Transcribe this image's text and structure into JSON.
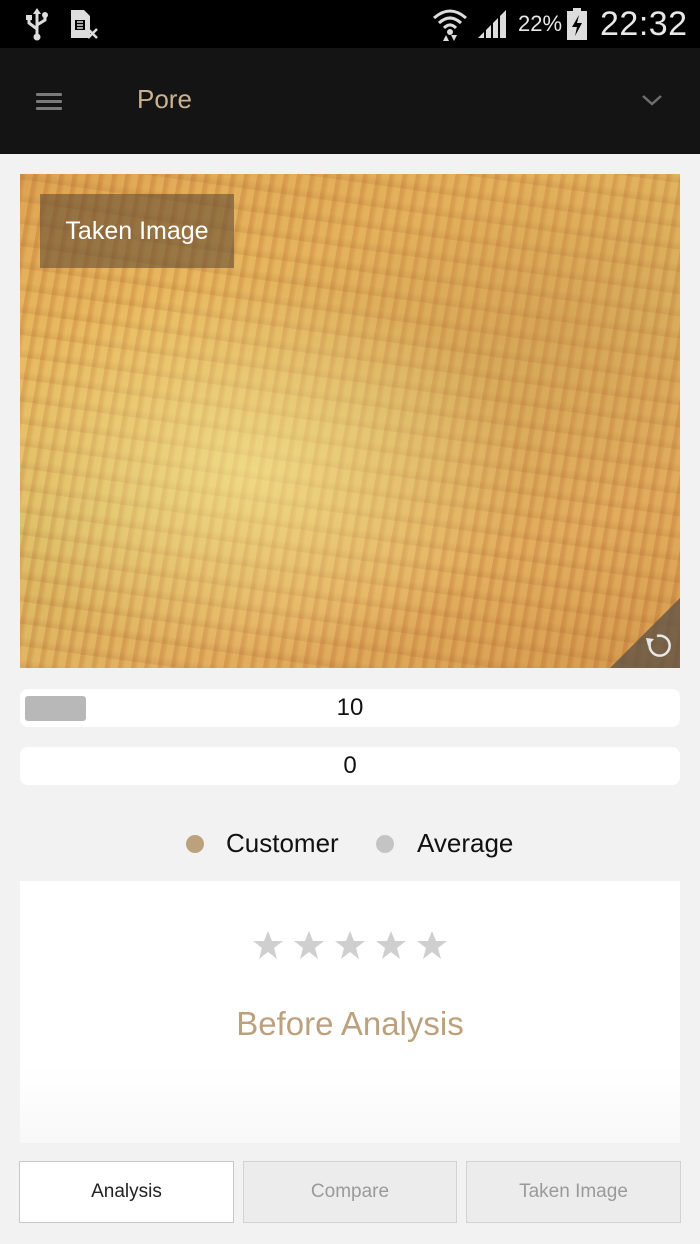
{
  "status_bar": {
    "battery_percent": "22%",
    "time": "22:32",
    "icons": [
      "usb-icon",
      "sim-missing-icon",
      "wifi-icon",
      "signal-icon",
      "battery-charging-icon"
    ]
  },
  "app_bar": {
    "title": "Pore",
    "icons": [
      "menu-icon",
      "chevron-down-icon"
    ]
  },
  "image_panel": {
    "label": "Taken Image",
    "icon": "rotate-icon"
  },
  "bars": [
    {
      "value": "10",
      "fill_fraction": 0.1
    },
    {
      "value": "0",
      "fill_fraction": 0
    }
  ],
  "legend": {
    "customer": "Customer",
    "average": "Average",
    "colors": {
      "customer": "#bca17e",
      "average": "#c4c4c4"
    }
  },
  "result": {
    "stars_total": 5,
    "stars_filled": 0,
    "status": "Before Analysis",
    "color": "#bca17e"
  },
  "tabs": {
    "analysis": "Analysis",
    "compare": "Compare",
    "taken_image": "Taken Image",
    "active": "analysis"
  }
}
